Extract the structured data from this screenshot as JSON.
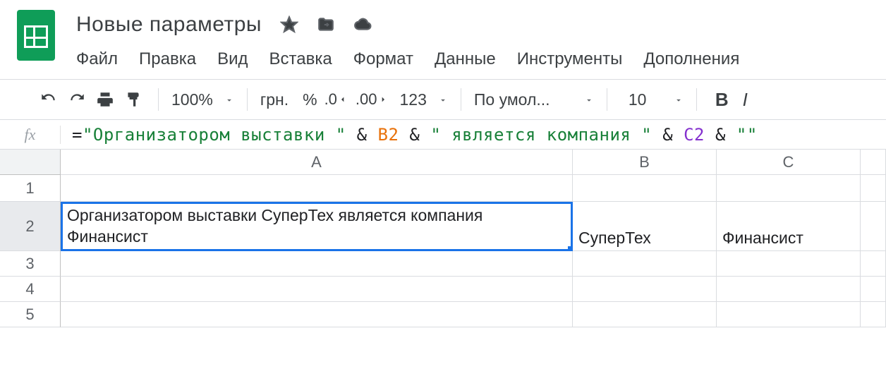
{
  "header": {
    "title": "Новые параметры"
  },
  "menubar": {
    "items": [
      "Файл",
      "Правка",
      "Вид",
      "Вставка",
      "Формат",
      "Данные",
      "Инструменты",
      "Дополнения"
    ]
  },
  "toolbar": {
    "zoom": "100%",
    "currency": "грн.",
    "percent": "%",
    "dec_less": ".0",
    "dec_more": ".00",
    "formats": "123",
    "font": "По умол...",
    "font_size": "10",
    "bold": "B",
    "italic": "I"
  },
  "formula": {
    "fx": "fx",
    "eq": "=",
    "s1": "\"Организатором выставки \"",
    "amp": " & ",
    "ref1": "B2",
    "s2": "\" является компания \"",
    "ref2": "C2",
    "s3": "\"\""
  },
  "grid": {
    "columns": [
      "A",
      "B",
      "C"
    ],
    "rows": [
      "1",
      "2",
      "3",
      "4",
      "5"
    ],
    "cells": {
      "A2": "Организатором выставки СуперТех является компания Финансист",
      "B2": "СуперТех",
      "C2": "Финансист"
    }
  }
}
